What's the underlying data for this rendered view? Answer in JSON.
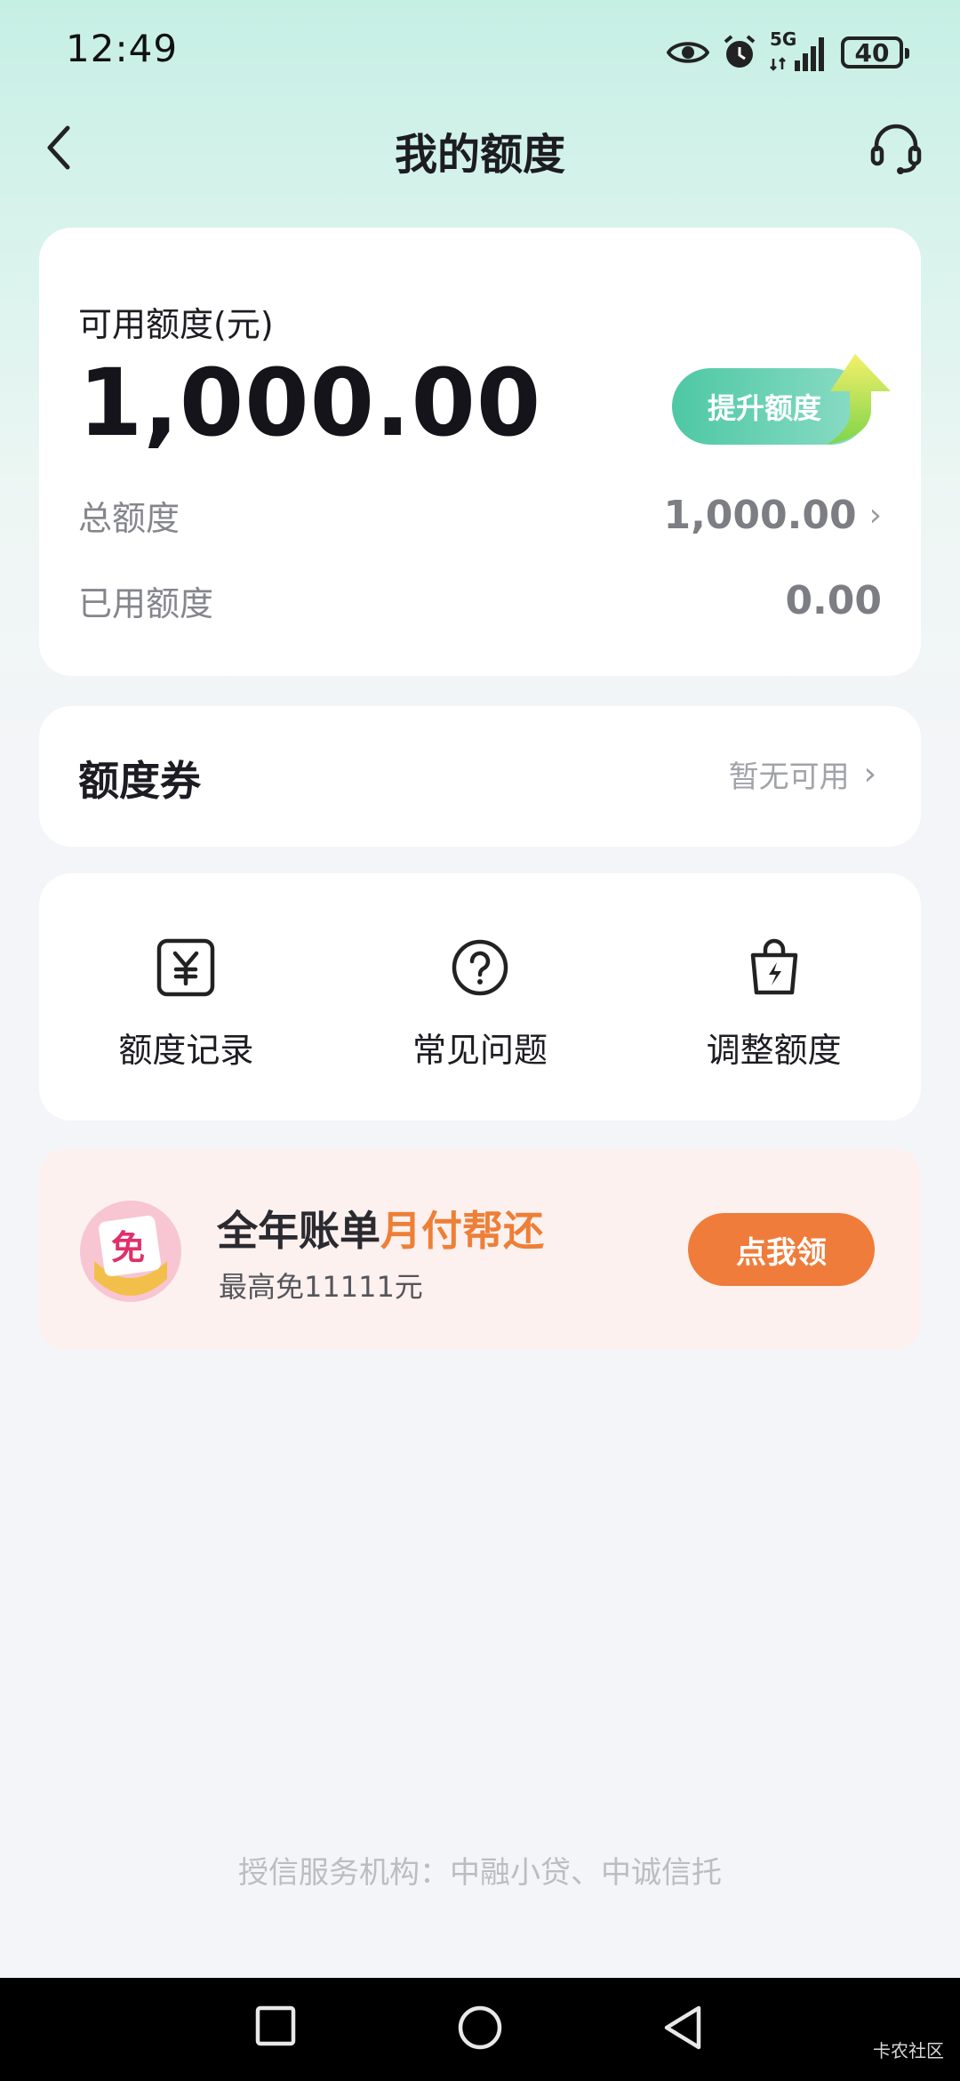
{
  "status_bar": {
    "time": "12:49",
    "network": "5G",
    "battery": "40"
  },
  "nav": {
    "title": "我的额度"
  },
  "credit": {
    "available_label": "可用额度(元)",
    "available_amount": "1,000.00",
    "raise_button": "提升额度",
    "total_label": "总额度",
    "total_value": "1,000.00",
    "used_label": "已用额度",
    "used_value": "0.00"
  },
  "coupon": {
    "label": "额度券",
    "status": "暂无可用"
  },
  "shortcuts": [
    {
      "label": "额度记录",
      "icon": "yuan-record-icon"
    },
    {
      "label": "常见问题",
      "icon": "question-icon"
    },
    {
      "label": "调整额度",
      "icon": "bag-lightning-icon"
    }
  ],
  "promo": {
    "icon_text": "免",
    "title_main": "全年账单",
    "title_highlight": "月付帮还",
    "subtitle": "最高免11111元",
    "button": "点我领"
  },
  "footer": {
    "text": "授信服务机构：中融小贷、中诚信托"
  },
  "watermark": "卡农社区",
  "colors": {
    "accent_green": "#4ec8a4",
    "accent_orange": "#ef7c3b",
    "header_gradient_top": "#c6efe4"
  }
}
